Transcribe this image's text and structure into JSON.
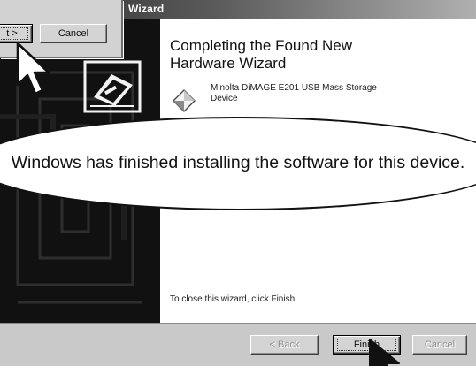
{
  "wizard": {
    "title": "Wizard",
    "heading": "Completing the Found New\nHardware Wizard",
    "device_name": "Minolta DiMAGE E201 USB Mass Storage\nDevice",
    "device_icon": "diamond-device-icon",
    "close_instruction": "To close this wizard, click Finish.",
    "buttons": {
      "back": "< Back",
      "finish": "Finish",
      "cancel": "Cancel"
    }
  },
  "background_dialog": {
    "next_label": "t >",
    "cancel_label": "Cancel"
  },
  "callout": {
    "text": "Windows has finished installing the software for this device."
  },
  "icons": {
    "hardware": "usb-hardware-icon",
    "pointer": "mouse-pointer-icon"
  },
  "colors": {
    "side_panel": "#111111",
    "window_face": "#c9c9c9",
    "title_bar": "#2b2b2b"
  }
}
